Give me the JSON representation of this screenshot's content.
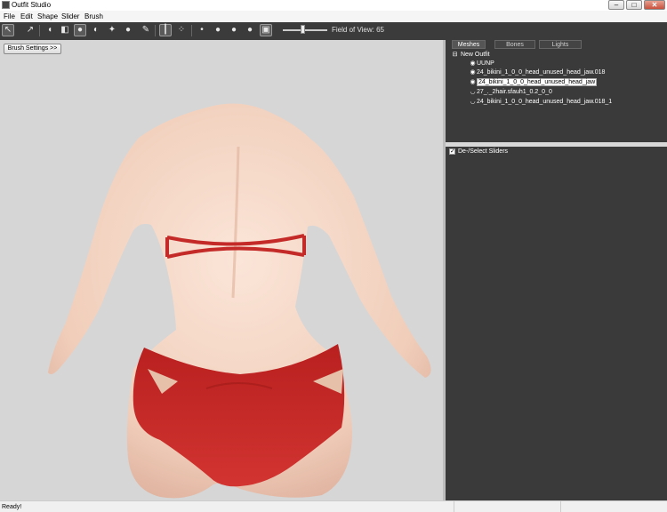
{
  "window": {
    "title": "Outfit Studio",
    "minimize": "–",
    "maximize": "□",
    "close": "✕"
  },
  "menu": [
    "File",
    "Edit",
    "Shape",
    "Slider",
    "Brush"
  ],
  "toolbar": {
    "fov_label": "Field of View: 65",
    "icons": [
      "select-tool-icon",
      "transform-tool-icon",
      "inflate-brush-icon",
      "deflate-brush-icon",
      "move-brush-icon",
      "smooth-brush-icon",
      "weight-brush-icon",
      "mask-brush-icon",
      "color-brush-icon",
      "view-front-icon",
      "view-side-icon",
      "brush-size-small-icon",
      "brush-size-medium-icon",
      "brush-size-large-icon",
      "brush-size-xlarge-icon",
      "texture-toggle-icon"
    ]
  },
  "viewport": {
    "brush_settings_label": "Brush Settings >>"
  },
  "right_panel": {
    "tabs": [
      "Meshes",
      "Bones",
      "Lights"
    ],
    "tree": {
      "root": "New Outfit",
      "items": [
        {
          "label": "UUNP",
          "icon": "eye-icon",
          "selected": false
        },
        {
          "label": "24_bikini_1_0_0_head_unused_head_jaw.018",
          "icon": "eye-icon",
          "selected": false
        },
        {
          "label": "24_bikini_1_0_0_head_unused_head_jaw",
          "icon": "eye-icon",
          "selected": true
        },
        {
          "label": "27_._2hair.sfauh1_0.2_0_0",
          "icon": "eye-closed-icon",
          "selected": false
        },
        {
          "label": "24_bikini_1_0_0_head_unused_head_jaw.018_1",
          "icon": "eye-closed-icon",
          "selected": false
        }
      ]
    },
    "sliders_header": "De-/Select Sliders",
    "sliders_checked": true
  },
  "status": {
    "text": "Ready!"
  },
  "colors": {
    "toolbar": "#3b3b3b",
    "panel": "#3a3a3a",
    "viewport": "#d6d6d6",
    "skin": "#f3d4c2",
    "bikini": "#c42a28"
  }
}
